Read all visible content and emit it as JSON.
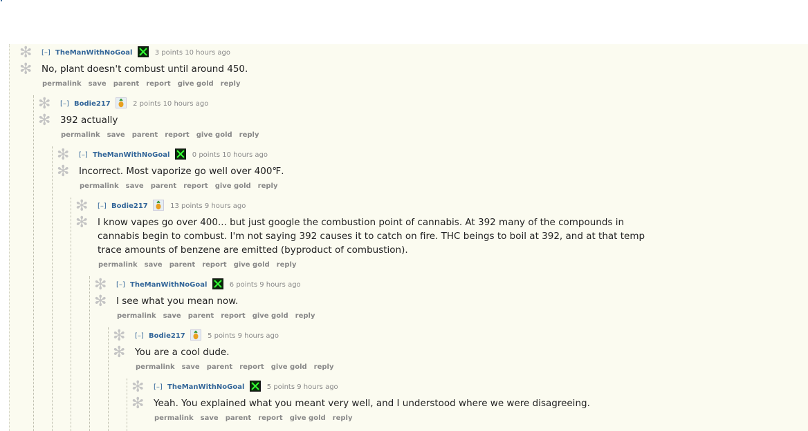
{
  "labels": {
    "collapse": "[–]",
    "permalink": "permalink",
    "save": "save",
    "parent": "parent",
    "report": "report",
    "give_gold": "give gold",
    "reply": "reply"
  },
  "comments": [
    {
      "author": "TheManWithNoGoal",
      "flair": "x-icon",
      "score": "3 points",
      "time": "10 hours ago",
      "lines": [
        "No, plant doesn't combust until around 450."
      ]
    },
    {
      "author": "Bodie217",
      "flair": "pineapple-icon",
      "score": "2 points",
      "time": "10 hours ago",
      "lines": [
        "392 actually"
      ]
    },
    {
      "author": "TheManWithNoGoal",
      "flair": "x-icon",
      "score": "0 points",
      "time": "10 hours ago",
      "lines": [
        "Incorrect. Most vaporize go well over 400℉."
      ]
    },
    {
      "author": "Bodie217",
      "flair": "pineapple-icon",
      "score": "13 points",
      "time": "9 hours ago",
      "lines": [
        "I know vapes go over 400... but just google the combustion point of cannabis. At 392 many of the compounds in",
        "cannabis begin to combust. I'm not saying 392 causes it to catch on fire. THC beings to boil at 392, and at that temp",
        "trace amounts of benzene are emitted (byproduct of combustion)."
      ]
    },
    {
      "author": "TheManWithNoGoal",
      "flair": "x-icon",
      "score": "6 points",
      "time": "9 hours ago",
      "lines": [
        "I see what you mean now."
      ]
    },
    {
      "author": "Bodie217",
      "flair": "pineapple-icon",
      "score": "5 points",
      "time": "9 hours ago",
      "lines": [
        "You are a cool dude."
      ]
    },
    {
      "author": "TheManWithNoGoal",
      "flair": "x-icon",
      "score": "5 points",
      "time": "9 hours ago",
      "lines": [
        "Yeah. You explained what you meant very well, and I understood where we were disagreeing."
      ]
    }
  ],
  "colors": {
    "background": "#fbfbf0",
    "author": "#336699",
    "meta": "#888888",
    "leaf": "#c4c4c4"
  }
}
